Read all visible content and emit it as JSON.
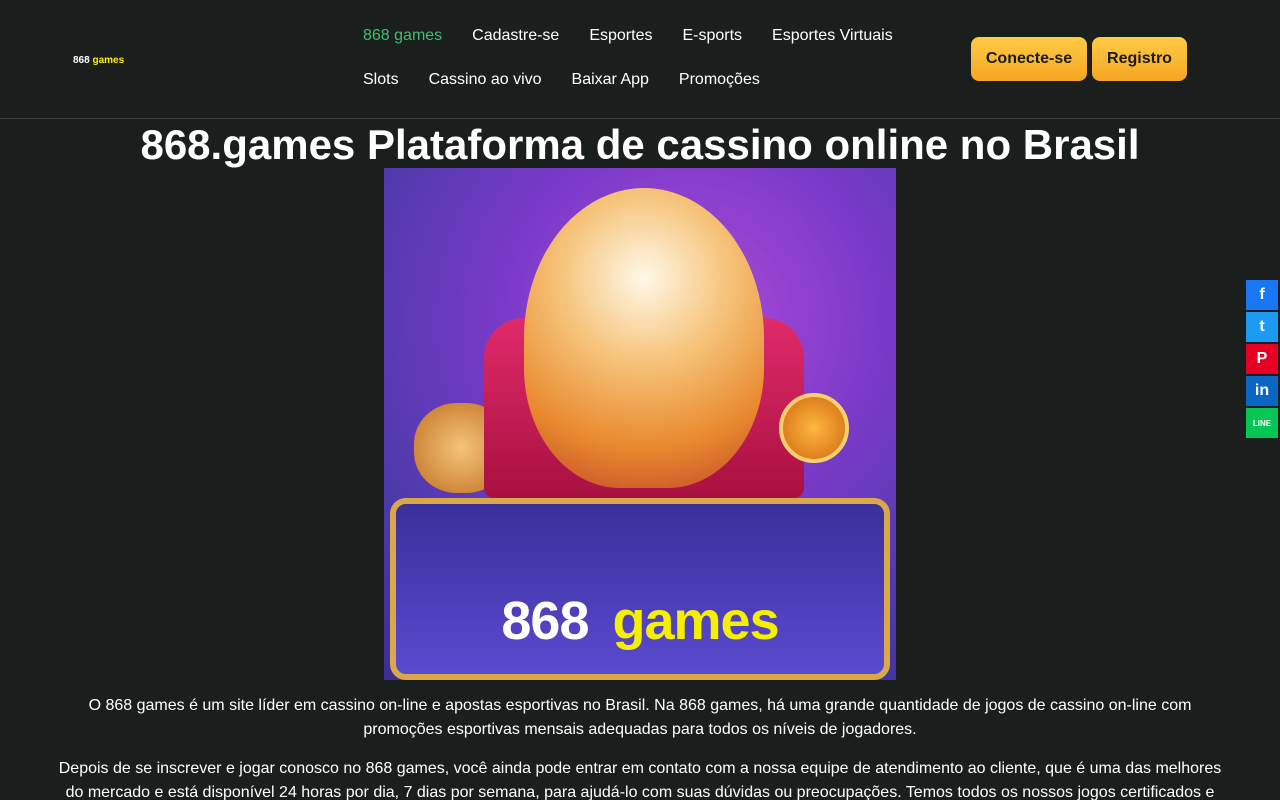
{
  "header": {
    "logo": {
      "part1": "868",
      "part2": "games"
    },
    "nav": [
      {
        "label": "868 games",
        "active": true
      },
      {
        "label": "Cadastre-se"
      },
      {
        "label": "Esportes"
      },
      {
        "label": "E-sports"
      },
      {
        "label": "Esportes Virtuais"
      },
      {
        "label": "Slots"
      },
      {
        "label": "Cassino ao vivo"
      },
      {
        "label": "Baixar App"
      },
      {
        "label": "Promoções"
      }
    ],
    "login_label": "Conecte-se",
    "register_label": "Registro"
  },
  "main": {
    "title": "868.games Plataforma de cassino online no Brasil",
    "hero": {
      "brand_part1": "868",
      "brand_part2": "games"
    },
    "paragraph1": "O 868 games é um site líder em cassino on-line e apostas esportivas no Brasil. Na 868 games, há uma grande quantidade de jogos de cassino on-line com promoções esportivas mensais adequadas para todos os níveis de jogadores.",
    "paragraph2": "Depois de se inscrever e jogar conosco no 868 games, você ainda pode entrar em contato com a nossa equipe de atendimento ao cliente, que é uma das melhores do mercado e está disponível 24 horas por dia, 7 dias por semana, para ajudá-lo com suas dúvidas ou preocupações. Temos todos os nossos jogos certificados e"
  },
  "share": {
    "icons": [
      "facebook-icon",
      "twitter-icon",
      "pinterest-icon",
      "linkedin-icon",
      "line-icon"
    ],
    "labels": {
      "facebook": "f",
      "twitter": "t",
      "pinterest": "P",
      "linkedin": "in",
      "line": "LINE"
    },
    "colors": {
      "facebook": "#1877f2",
      "twitter": "#1d9bf0",
      "pinterest": "#e60023",
      "linkedin": "#0a66c2",
      "line": "#06c755"
    }
  },
  "colors": {
    "background": "#1a1f1d",
    "accent": "#f5a623",
    "active_nav": "#3fbf6f",
    "logo_yellow": "#ffee00"
  }
}
